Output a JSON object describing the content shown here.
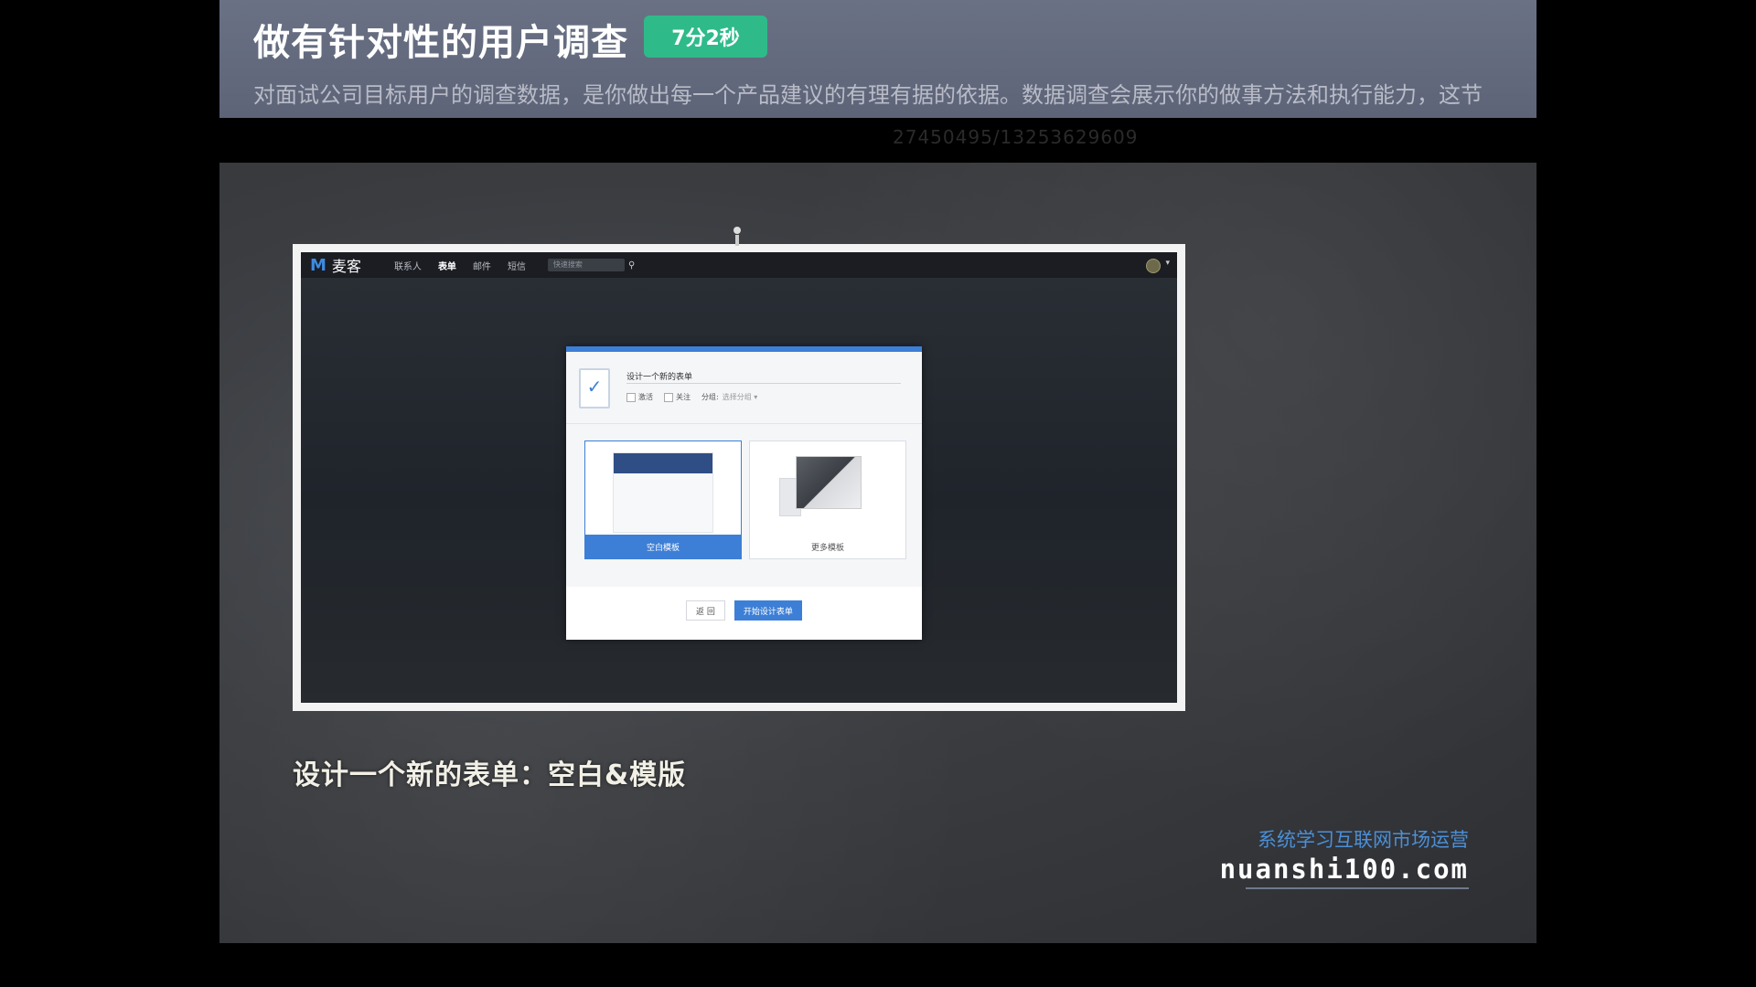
{
  "header": {
    "title": "做有针对性的用户调查",
    "duration": "7分2秒",
    "subtitle": "对面试公司目标用户的调查数据，是你做出每一个产品建议的有理有据的依据。数据调查会展示你的做事方法和执行能力，这节"
  },
  "watermark_id": "27450495/13253629609",
  "app": {
    "logo_mark": "M",
    "logo_text": "麦客",
    "nav": [
      "联系人",
      "表单",
      "邮件",
      "短信"
    ],
    "search_placeholder": "快速搜索",
    "search_icon": "search-icon",
    "caret": "▾"
  },
  "dialog": {
    "form_icon": "✓",
    "form_name": "设计一个新的表单",
    "options": [
      "激活",
      "关注"
    ],
    "group_label": "分组:",
    "group_value": "选择分组 ▾",
    "templates": [
      "空白模板",
      "更多模板"
    ],
    "back_label": "返 回",
    "start_label": "开始设计表单"
  },
  "caption": "设计一个新的表单：空白&模版",
  "brand": {
    "slogan": "系统学习互联网市场运营",
    "url": "nuanshi100.com"
  },
  "colors": {
    "accent": "#3d7fd6",
    "duration_badge": "#2fba8a",
    "header_bg": "#656c80"
  }
}
